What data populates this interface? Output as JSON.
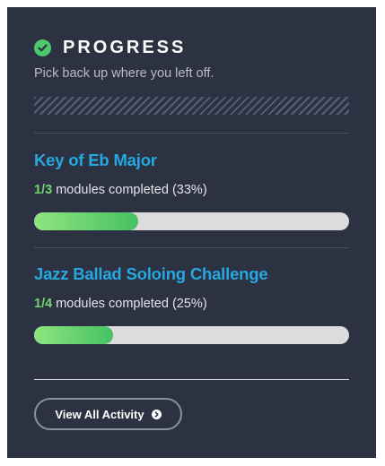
{
  "header": {
    "title": "PROGRESS",
    "subtitle": "Pick back up where you left off.",
    "icon": "check-circle-icon"
  },
  "courses": [
    {
      "title": "Key of Eb Major",
      "completed": "1/3",
      "suffix": " modules completed (33%)",
      "progress": 0.33
    },
    {
      "title": "Jazz Ballad Soloing Challenge",
      "completed": "1/4",
      "suffix": " modules completed (25%)",
      "progress": 0.25
    }
  ],
  "footer": {
    "button_label": "View All Activity",
    "button_icon": "chevron-right-circle-icon"
  },
  "colors": {
    "card_bg": "#2d3243",
    "link": "#25a9e0",
    "accent_green": "#4ec86d"
  }
}
